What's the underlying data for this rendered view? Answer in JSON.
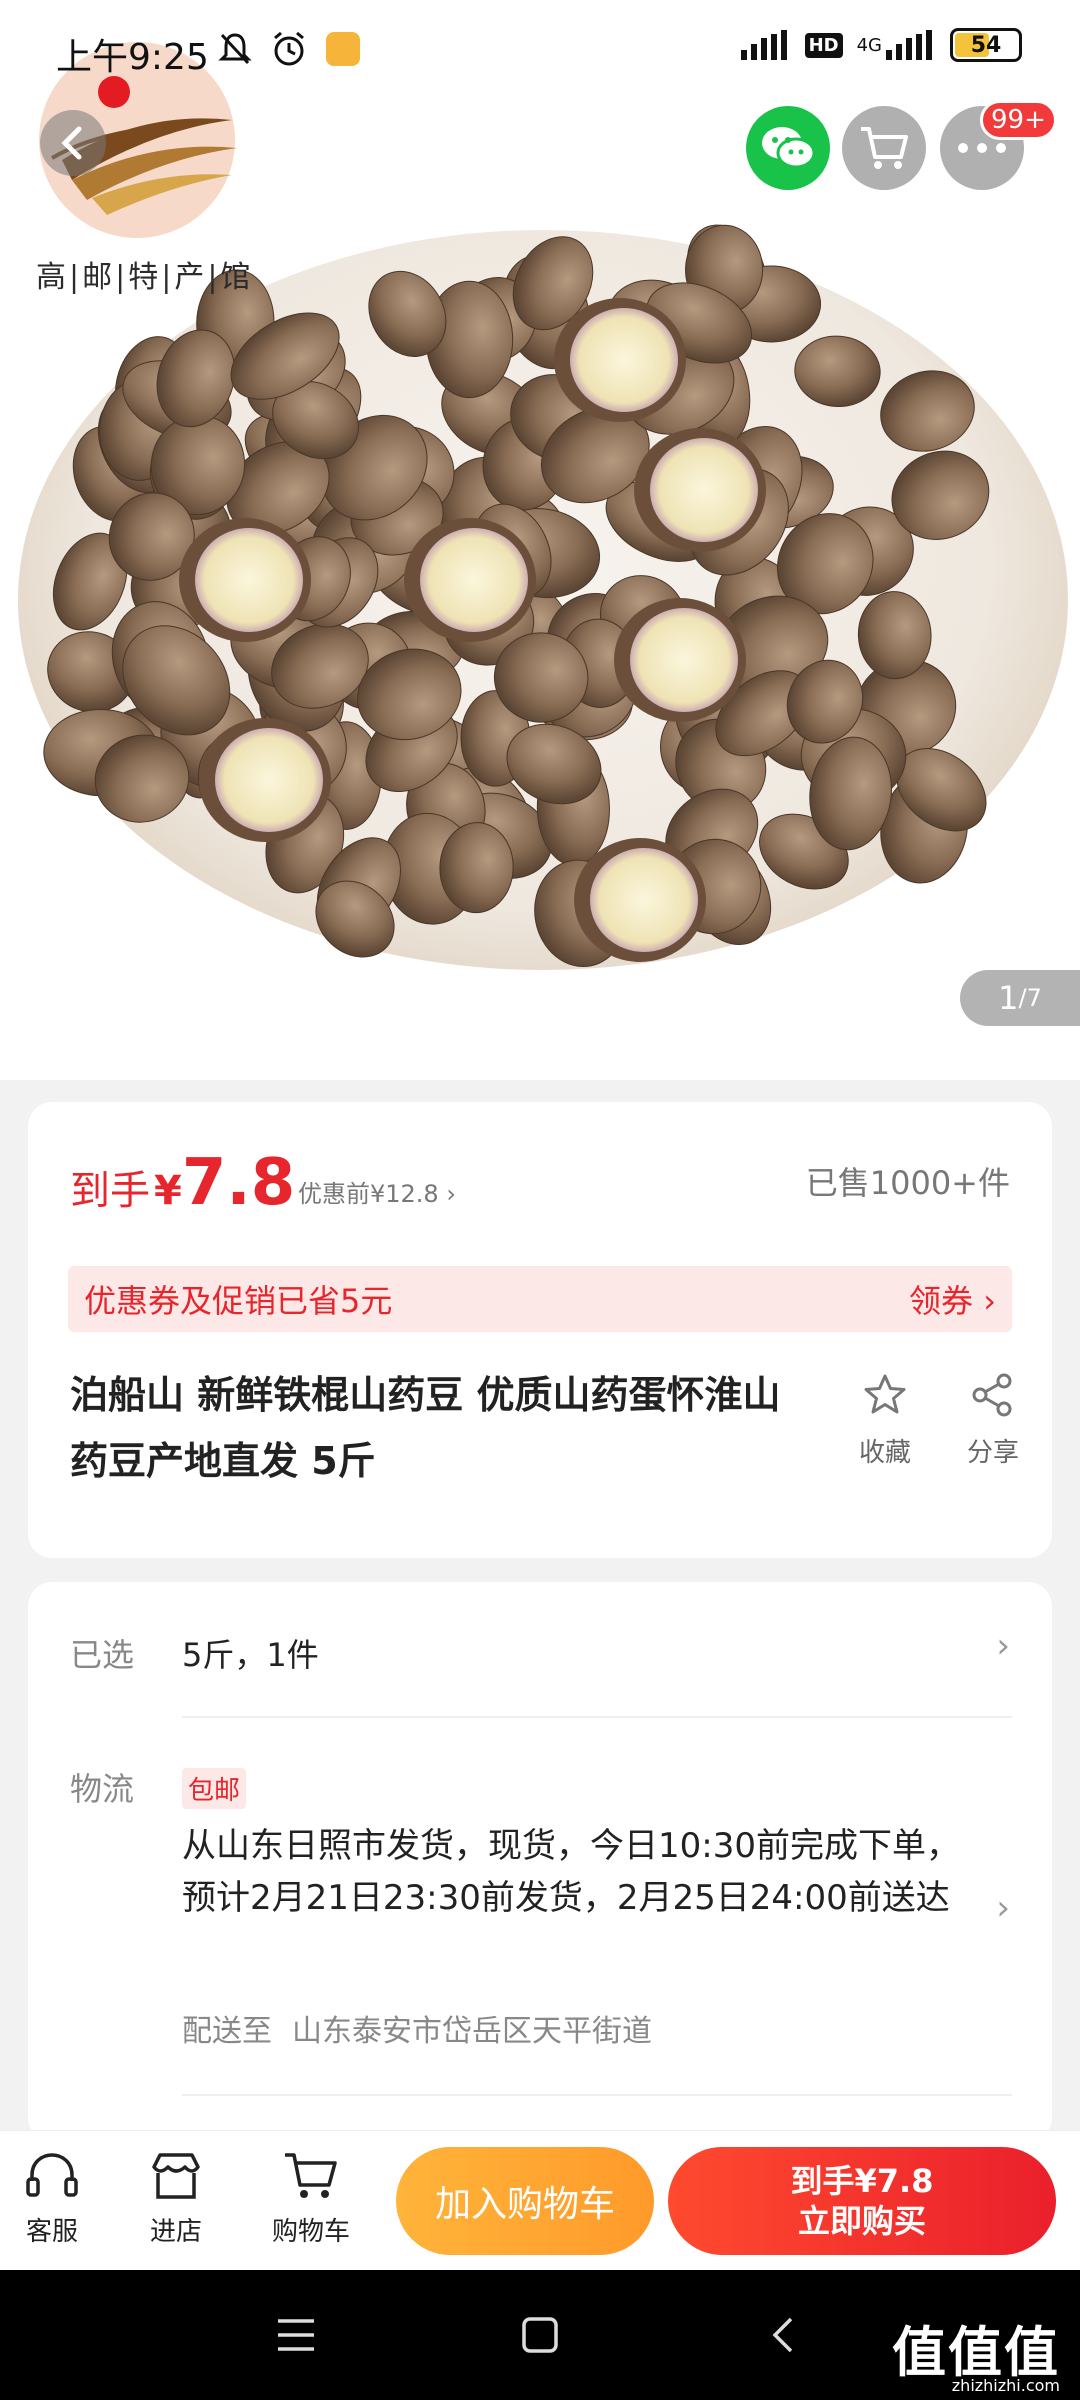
{
  "status_bar": {
    "time": "上午9:25",
    "network_hd": "HD",
    "network_4g": "4G",
    "battery": "54"
  },
  "logo": {
    "shop_name": "高|邮|特|产|馆"
  },
  "top_actions": {
    "more_badge": "99+"
  },
  "gallery": {
    "current": "1",
    "total": "/7"
  },
  "price": {
    "label": "到手",
    "currency": "¥",
    "amount": "7.8",
    "original": "优惠前¥12.8 ›",
    "sold": "已售1000+件"
  },
  "coupon": {
    "text": "优惠券及促销已省5元",
    "action": "领券 ›"
  },
  "product": {
    "title": "泊船山 新鲜铁棍山药豆 优质山药蛋怀淮山药豆产地直发 5斤",
    "favorite_label": "收藏",
    "share_label": "分享"
  },
  "selection": {
    "label": "已选",
    "value": "5斤，1件"
  },
  "logistics": {
    "label": "物流",
    "tag": "包邮",
    "detail": "从山东日照市发货，现货，今日10:30前完成下单，预计2月21日23:30前发货，2月25日24:00前送达",
    "dest_label": "配送至",
    "dest_value": "山东泰安市岱岳区天平街道"
  },
  "action_bar": {
    "service": "客服",
    "store": "进店",
    "cart": "购物车",
    "add_to_cart": "加入购物车",
    "buy_price": "到手¥7.8",
    "buy_now": "立即购买"
  },
  "watermark": {
    "main": "值值值",
    "sub": "zhizhizhi.com"
  }
}
